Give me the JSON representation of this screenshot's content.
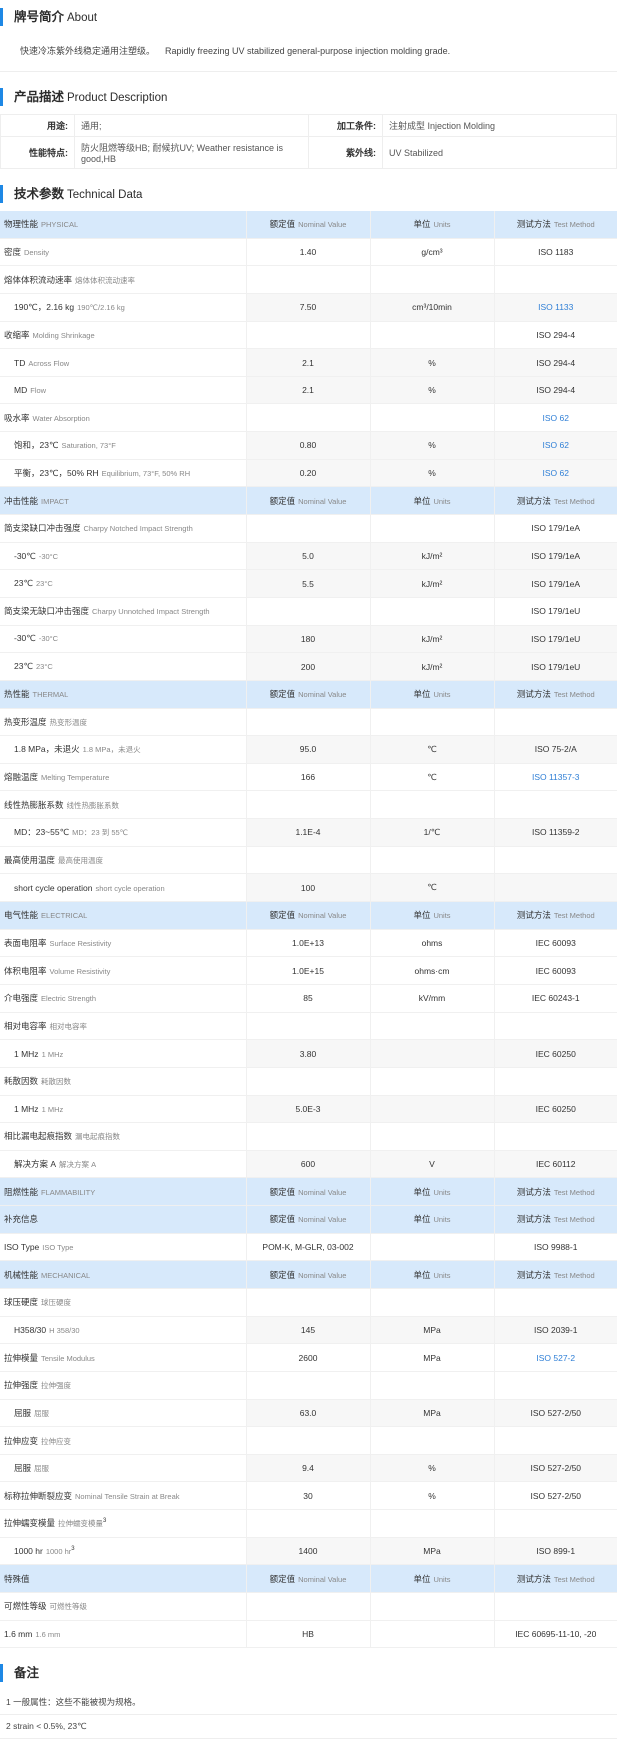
{
  "about": {
    "title_zh": "牌号简介",
    "title_en": "About",
    "text_zh": "快速冷冻紫外线稳定通用注塑级。",
    "text_en": "Rapidly freezing UV stabilized general-purpose injection molding grade."
  },
  "description": {
    "title_zh": "产品描述",
    "title_en": "Product Description",
    "rows": [
      {
        "l1": "用途:",
        "v1": "通用;",
        "l2": "加工条件:",
        "v2": "注射成型 Injection Molding"
      },
      {
        "l1": "性能特点:",
        "v1": "防火阻燃等级HB; 耐候抗UV; Weather resistance is good,HB",
        "l2": "紫外线:",
        "v2": "UV Stabilized"
      }
    ]
  },
  "technical": {
    "title_zh": "技术参数",
    "title_en": "Technical Data",
    "colhdr": {
      "nominal": "额定值",
      "nominal_en": "Nominal Value",
      "unit": "单位",
      "unit_en": "Units",
      "method": "测试方法",
      "method_en": "Test Method"
    },
    "rows": [
      {
        "t": "hdr",
        "zh": "物理性能",
        "en": "PHYSICAL"
      },
      {
        "t": "prop",
        "zh": "密度",
        "en": "Density",
        "v": "1.40",
        "u": "g/cm³",
        "m": "ISO 1183",
        "link": false
      },
      {
        "t": "cat",
        "zh": "熔体体积流动速率",
        "en": "熔体体积流动速率"
      },
      {
        "t": "sub",
        "zh": "190℃，2.16 kg",
        "en": "190℃/2.16 kg",
        "v": "7.50",
        "u": "cm³/10min",
        "m": "ISO 1133",
        "link": true
      },
      {
        "t": "cat",
        "zh": "收缩率",
        "en": "Molding Shrinkage",
        "m": "ISO 294-4"
      },
      {
        "t": "sub",
        "zh": "TD",
        "en": "Across Flow",
        "v": "2.1",
        "u": "%",
        "m": "ISO 294-4",
        "link": false
      },
      {
        "t": "sub",
        "zh": "MD",
        "en": "Flow",
        "v": "2.1",
        "u": "%",
        "m": "ISO 294-4",
        "link": false
      },
      {
        "t": "cat",
        "zh": "吸水率",
        "en": "Water Absorption",
        "m": "ISO 62",
        "link": true
      },
      {
        "t": "sub",
        "zh": "饱和，23℃",
        "en": "Saturation, 73°F",
        "v": "0.80",
        "u": "%",
        "m": "ISO 62",
        "link": true
      },
      {
        "t": "sub",
        "zh": "平衡，23℃，50% RH",
        "en": "Equilibrium, 73°F, 50% RH",
        "v": "0.20",
        "u": "%",
        "m": "ISO 62",
        "link": true
      },
      {
        "t": "hdr",
        "zh": "冲击性能",
        "en": "IMPACT"
      },
      {
        "t": "cat",
        "zh": "简支梁缺口冲击强度",
        "en": "Charpy Notched Impact Strength",
        "m": "ISO 179/1eA"
      },
      {
        "t": "sub",
        "zh": "-30℃",
        "en": "-30°C",
        "v": "5.0",
        "u": "kJ/m²",
        "m": "ISO 179/1eA",
        "link": false
      },
      {
        "t": "sub",
        "zh": "23℃",
        "en": "23°C",
        "v": "5.5",
        "u": "kJ/m²",
        "m": "ISO 179/1eA",
        "link": false
      },
      {
        "t": "cat",
        "zh": "简支梁无缺口冲击强度",
        "en": "Charpy Unnotched Impact Strength",
        "m": "ISO 179/1eU"
      },
      {
        "t": "sub",
        "zh": "-30℃",
        "en": "-30°C",
        "v": "180",
        "u": "kJ/m²",
        "m": "ISO 179/1eU",
        "link": false
      },
      {
        "t": "sub",
        "zh": "23℃",
        "en": "23°C",
        "v": "200",
        "u": "kJ/m²",
        "m": "ISO 179/1eU",
        "link": false
      },
      {
        "t": "hdr",
        "zh": "热性能",
        "en": "THERMAL"
      },
      {
        "t": "cat",
        "zh": "热变形温度",
        "en": "热变形温度"
      },
      {
        "t": "sub",
        "zh": "1.8 MPa，未退火",
        "en": "1.8 MPa，未退火",
        "v": "95.0",
        "u": "℃",
        "m": "ISO 75-2/A",
        "link": false
      },
      {
        "t": "prop",
        "zh": "熔融温度",
        "en": "Melting Temperature",
        "v": "166",
        "u": "℃",
        "m": "ISO 11357-3",
        "link": true
      },
      {
        "t": "cat",
        "zh": "线性热膨胀系数",
        "en": "线性热膨胀系数"
      },
      {
        "t": "sub",
        "zh": "MD：23~55℃",
        "en": "MD：23 到 55℃",
        "v": "1.1E-4",
        "u": "1/℃",
        "m": "ISO 11359-2",
        "link": false
      },
      {
        "t": "cat",
        "zh": "最高使用温度",
        "en": "最高使用温度"
      },
      {
        "t": "sub",
        "zh": "short cycle operation",
        "en": "short cycle operation",
        "v": "100",
        "u": "℃",
        "m": "",
        "link": false
      },
      {
        "t": "hdr",
        "zh": "电气性能",
        "en": "ELECTRICAL"
      },
      {
        "t": "prop",
        "zh": "表面电阻率",
        "en": "Surface Resistivity",
        "v": "1.0E+13",
        "u": "ohms",
        "m": "IEC 60093",
        "link": false
      },
      {
        "t": "prop",
        "zh": "体积电阻率",
        "en": "Volume Resistivity",
        "v": "1.0E+15",
        "u": "ohms·cm",
        "m": "IEC 60093",
        "link": false
      },
      {
        "t": "prop",
        "zh": "介电强度",
        "en": "Electric Strength",
        "v": "85",
        "u": "kV/mm",
        "m": "IEC 60243-1",
        "link": false
      },
      {
        "t": "cat",
        "zh": "相对电容率",
        "en": "相对电容率"
      },
      {
        "t": "sub",
        "zh": "1 MHz",
        "en": "1 MHz",
        "v": "3.80",
        "u": "",
        "m": "IEC 60250",
        "link": false
      },
      {
        "t": "cat",
        "zh": "耗散因数",
        "en": "耗散因数"
      },
      {
        "t": "sub",
        "zh": "1 MHz",
        "en": "1 MHz",
        "v": "5.0E-3",
        "u": "",
        "m": "IEC 60250",
        "link": false
      },
      {
        "t": "cat",
        "zh": "相比漏电起痕指数",
        "en": "漏电起痕指数"
      },
      {
        "t": "sub",
        "zh": "解决方案 A",
        "en": "解决方案 A",
        "v": "600",
        "u": "V",
        "m": "IEC 60112",
        "link": false
      },
      {
        "t": "hdr",
        "zh": "阻燃性能",
        "en": "FLAMMABILITY"
      },
      {
        "t": "hdr",
        "zh": "补充信息",
        "en": ""
      },
      {
        "t": "prop",
        "zh": "ISO Type",
        "en": "ISO Type",
        "v": "POM-K, M-GLR, 03-002",
        "u": "",
        "m": "ISO 9988-1",
        "link": false
      },
      {
        "t": "hdr",
        "zh": "机械性能",
        "en": "MECHANICAL"
      },
      {
        "t": "cat",
        "zh": "球压硬度",
        "en": "球压硬度"
      },
      {
        "t": "sub",
        "zh": "H358/30",
        "en": "H 358/30",
        "v": "145",
        "u": "MPa",
        "m": "ISO 2039-1",
        "link": false
      },
      {
        "t": "prop",
        "zh": "拉伸模量",
        "en": "Tensile Modulus",
        "v": "2600",
        "u": "MPa",
        "m": "ISO 527-2",
        "link": true
      },
      {
        "t": "cat",
        "zh": "拉伸强度",
        "en": "拉伸强度"
      },
      {
        "t": "sub",
        "zh": "屈服",
        "en": "屈服",
        "v": "63.0",
        "u": "MPa",
        "m": "ISO 527-2/50",
        "link": false
      },
      {
        "t": "cat",
        "zh": "拉伸应变",
        "en": "拉伸应变"
      },
      {
        "t": "sub",
        "zh": "屈服",
        "en": "屈服",
        "v": "9.4",
        "u": "%",
        "m": "ISO 527-2/50",
        "link": false
      },
      {
        "t": "prop",
        "zh": "标称拉伸断裂应变",
        "en": "Nominal Tensile Strain at Break",
        "v": "30",
        "u": "%",
        "m": "ISO 527-2/50",
        "link": false
      },
      {
        "t": "cat",
        "zh": "拉伸蠕变模量",
        "en": "拉伸蠕变模量",
        "sup": "3"
      },
      {
        "t": "sub",
        "zh": "1000 hr",
        "en": "1000 hr",
        "sup": "3",
        "v": "1400",
        "u": "MPa",
        "m": "ISO 899-1",
        "link": false
      },
      {
        "t": "hdr",
        "zh": "特殊值",
        "en": ""
      },
      {
        "t": "cat",
        "zh": "可燃性等级",
        "en": "可燃性等级"
      },
      {
        "t": "prop",
        "zh": "1.6 mm",
        "en": "1.6 mm",
        "v": "HB",
        "u": "",
        "m": "IEC 60695-11-10, -20",
        "link": false
      }
    ]
  },
  "notes": {
    "title_zh": "备注",
    "items": [
      "1 一般属性：这些不能被视为规格。",
      "2 strain < 0.5%, 23℃"
    ]
  }
}
